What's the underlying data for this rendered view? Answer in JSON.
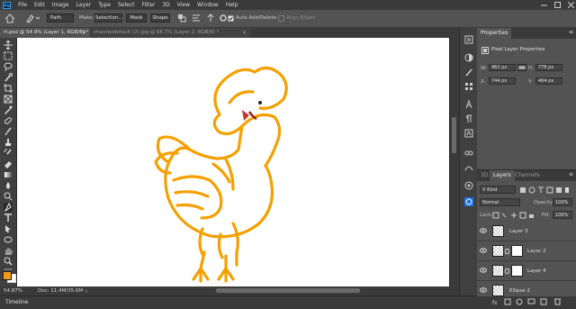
{
  "app": {
    "logo": "Ps"
  },
  "menu": [
    "File",
    "Edit",
    "Image",
    "Layer",
    "Type",
    "Select",
    "Filter",
    "3D",
    "View",
    "Window",
    "Help"
  ],
  "options": {
    "mode_value": "Path",
    "make_label": "Make:",
    "selection_button": "Selection...",
    "mask_button": "Mask",
    "shape_button": "Shape",
    "auto_add_delete": "Auto Add/Delete",
    "align_edges": "Align Edges"
  },
  "tabs": [
    {
      "label": "rt.psd @ 54.9% (Layer 1, RGB/8) *"
    },
    {
      "label": "imaxresdefault (2).jpg @ 66.7% (Layer 2, RGB/8) *"
    }
  ],
  "status": {
    "zoom": "54.87%",
    "doc": "Doc: 11.4M/35.6M"
  },
  "timeline_label": "Timeline",
  "properties": {
    "title": "Properties",
    "subtitle": "Pixel Layer Properties",
    "w_label": "W:",
    "w_value": "462 px",
    "h_label": "H:",
    "h_value": "778 px",
    "x_label": "X:",
    "x_value": "744 px",
    "y_label": "Y:",
    "y_value": "464 px"
  },
  "layers_panel": {
    "tabs": [
      "3D",
      "Layers",
      "Channels"
    ],
    "kind_label": "Kind",
    "blend_mode": "Normal",
    "opacity_label": "Opacity:",
    "opacity_value": "100%",
    "lock_label": "Lock:",
    "fill_label": "Fill:",
    "fill_value": "100%",
    "layers": [
      {
        "name": "Layer 3",
        "has_mask": false
      },
      {
        "name": "Layer 2",
        "has_mask": true
      },
      {
        "name": "Layer 4",
        "has_mask": true
      },
      {
        "name": "Ellipse 2",
        "has_mask": false
      }
    ]
  },
  "colors": {
    "foreground": "#f39a1a",
    "background": "#ffffff",
    "drawing_stroke": "#f5a000",
    "accent": "#2fa3f7"
  }
}
